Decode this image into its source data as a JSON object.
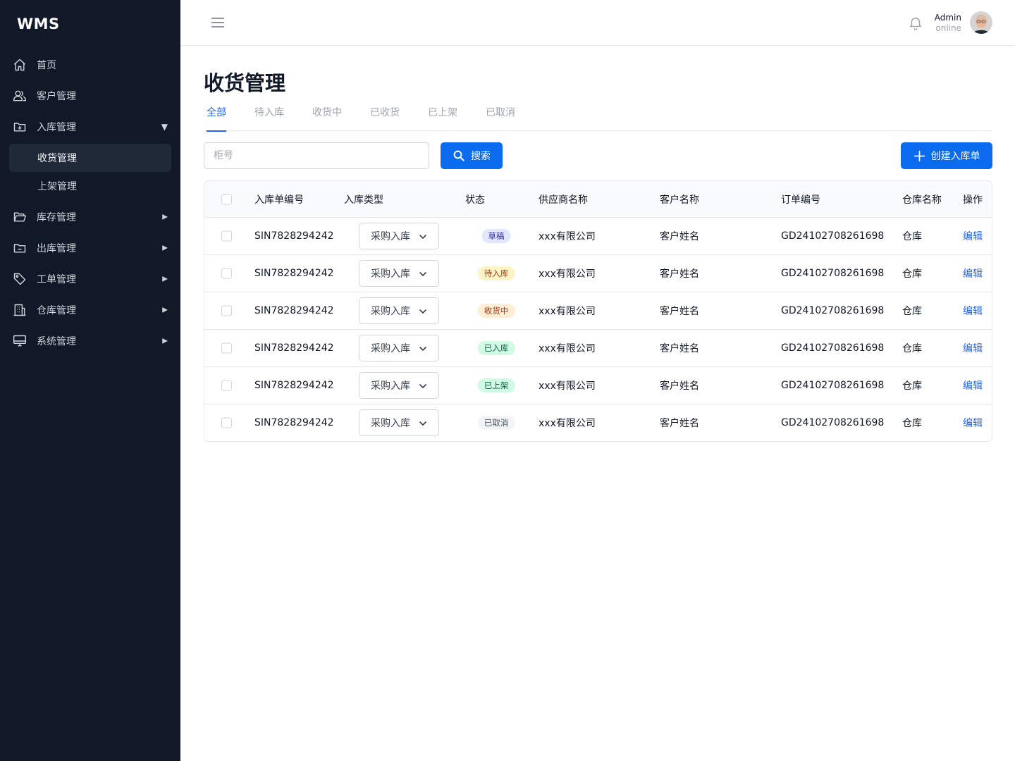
{
  "brand": "WMS",
  "sidebar": {
    "items": [
      {
        "label": "首页",
        "icon": "home-icon"
      },
      {
        "label": "客户管理",
        "icon": "users-icon"
      },
      {
        "label": "入库管理",
        "icon": "folder-plus-icon",
        "expanded": true,
        "children": [
          {
            "label": "收货管理",
            "active": true
          },
          {
            "label": "上架管理"
          }
        ]
      },
      {
        "label": "库存管理",
        "icon": "folder-open-icon"
      },
      {
        "label": "出库管理",
        "icon": "folder-minus-icon"
      },
      {
        "label": "工单管理",
        "icon": "tag-icon"
      },
      {
        "label": "仓库管理",
        "icon": "building-icon"
      },
      {
        "label": "系统管理",
        "icon": "monitor-icon"
      }
    ]
  },
  "header": {
    "user_name": "Admin",
    "user_status": "online"
  },
  "page": {
    "title": "收货管理",
    "tabs": [
      "全部",
      "待入库",
      "收货中",
      "已收货",
      "已上架",
      "已取消"
    ],
    "active_tab": 0
  },
  "search": {
    "placeholder": "柜号",
    "value": "",
    "button_label": "搜索"
  },
  "create_button_label": "创建入库单",
  "table": {
    "headers": [
      "入库单编号",
      "入库类型",
      "状态",
      "供应商名称",
      "客户名称",
      "订单编号",
      "仓库名称",
      "操作"
    ],
    "rows": [
      {
        "id": "SIN7828294242",
        "type": "采购入库",
        "status": "草稿",
        "supplier": "xxx有限公司",
        "customer": "客户姓名",
        "order": "GD24102708261698",
        "warehouse": "仓库",
        "action": "编辑"
      },
      {
        "id": "SIN7828294242",
        "type": "采购入库",
        "status": "待入库",
        "supplier": "xxx有限公司",
        "customer": "客户姓名",
        "order": "GD24102708261698",
        "warehouse": "仓库",
        "action": "编辑"
      },
      {
        "id": "SIN7828294242",
        "type": "采购入库",
        "status": "收货中",
        "supplier": "xxx有限公司",
        "customer": "客户姓名",
        "order": "GD24102708261698",
        "warehouse": "仓库",
        "action": "编辑"
      },
      {
        "id": "SIN7828294242",
        "type": "采购入库",
        "status": "已入库",
        "supplier": "xxx有限公司",
        "customer": "客户姓名",
        "order": "GD24102708261698",
        "warehouse": "仓库",
        "action": "编辑"
      },
      {
        "id": "SIN7828294242",
        "type": "采购入库",
        "status": "已上架",
        "supplier": "xxx有限公司",
        "customer": "客户姓名",
        "order": "GD24102708261698",
        "warehouse": "仓库",
        "action": "编辑"
      },
      {
        "id": "SIN7828294242",
        "type": "采购入库",
        "status": "已取消",
        "supplier": "xxx有限公司",
        "customer": "客户姓名",
        "order": "GD24102708261698",
        "warehouse": "仓库",
        "action": "编辑"
      }
    ]
  },
  "status_colors": {
    "草稿": {
      "bg": "#e0e7ff",
      "fg": "#3730a3"
    },
    "待入库": {
      "bg": "#fef3c7",
      "fg": "#92400e"
    },
    "收货中": {
      "bg": "#ffedd5",
      "fg": "#9a3412"
    },
    "已入库": {
      "bg": "#d1fae5",
      "fg": "#065f46"
    },
    "已上架": {
      "bg": "#d1fae5",
      "fg": "#065f46"
    },
    "已取消": {
      "bg": "#f3f4f6",
      "fg": "#4b5563"
    }
  },
  "colors": {
    "sidebar_bg": "#111827",
    "accent": "#0b6bef",
    "link": "#2563eb"
  }
}
